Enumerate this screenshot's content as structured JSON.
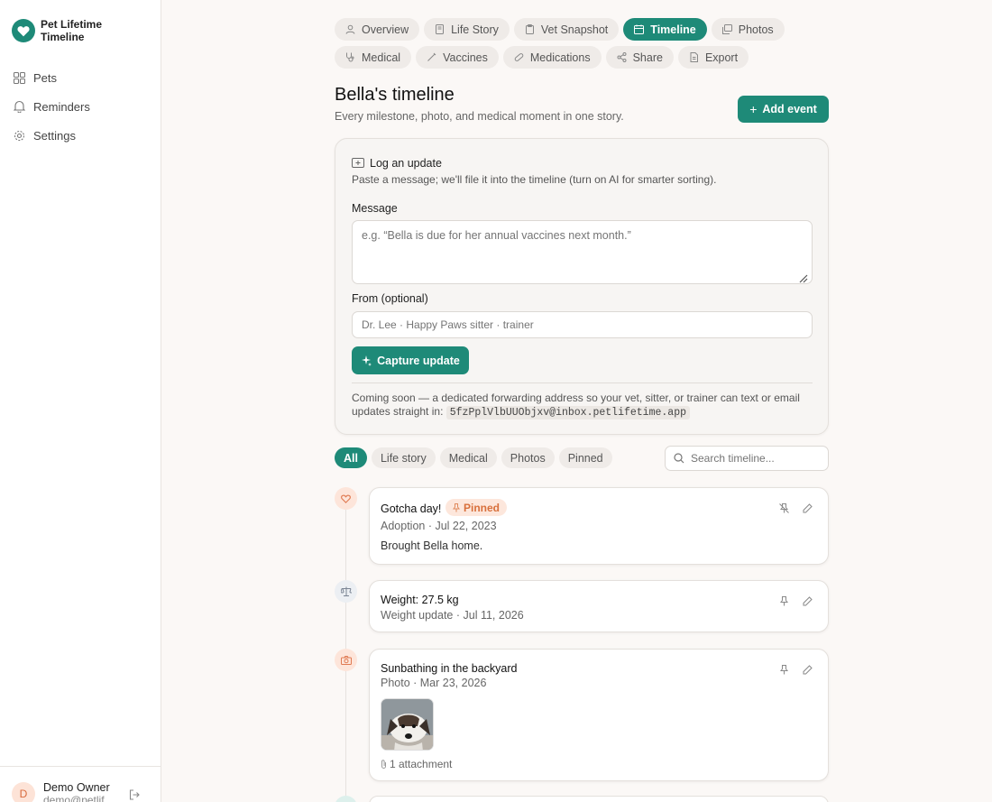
{
  "app": {
    "name": "Pet Lifetime Timeline"
  },
  "sidebar": {
    "items": [
      {
        "label": "Pets",
        "icon": "grid-icon"
      },
      {
        "label": "Reminders",
        "icon": "bell-icon"
      },
      {
        "label": "Settings",
        "icon": "gear-icon"
      }
    ],
    "user": {
      "initial": "D",
      "name": "Demo Owner",
      "email": "demo@petlif"
    }
  },
  "tabs": [
    {
      "label": "Overview",
      "icon": "user-icon",
      "active": false
    },
    {
      "label": "Life Story",
      "icon": "book-icon",
      "active": false
    },
    {
      "label": "Vet Snapshot",
      "icon": "clipboard-icon",
      "active": false
    },
    {
      "label": "Timeline",
      "icon": "calendar-icon",
      "active": true
    },
    {
      "label": "Photos",
      "icon": "images-icon",
      "active": false
    },
    {
      "label": "Medical",
      "icon": "stethoscope-icon",
      "active": false
    },
    {
      "label": "Vaccines",
      "icon": "syringe-icon",
      "active": false
    },
    {
      "label": "Medications",
      "icon": "pill-icon",
      "active": false
    },
    {
      "label": "Share",
      "icon": "share-icon",
      "active": false
    },
    {
      "label": "Export",
      "icon": "file-icon",
      "active": false
    }
  ],
  "header": {
    "title": "Bella's timeline",
    "subtitle": "Every milestone, photo, and medical moment in one story.",
    "add_event": "Add event"
  },
  "log": {
    "title": "Log an update",
    "description": "Paste a message; we'll file it into the timeline (turn on AI for smarter sorting).",
    "message_label": "Message",
    "message_placeholder": "e.g. “Bella is due for her annual vaccines next month.”",
    "from_label": "From (optional)",
    "from_placeholder": "Dr. Lee · Happy Paws sitter · trainer",
    "capture_label": "Capture update",
    "coming_soon": "Coming soon — a dedicated forwarding address so your vet, sitter, or trainer can text or email updates straight in:",
    "address": "5fzPplVlbUUObjxv@inbox.petlifetime.app"
  },
  "filters": {
    "chips": [
      {
        "label": "All",
        "active": true
      },
      {
        "label": "Life story",
        "active": false
      },
      {
        "label": "Medical",
        "active": false
      },
      {
        "label": "Photos",
        "active": false
      },
      {
        "label": "Pinned",
        "active": false
      }
    ],
    "search_placeholder": "Search timeline..."
  },
  "events": [
    {
      "title": "Gotcha day!",
      "badge": "Pinned",
      "meta": "Adoption · Jul 22, 2023",
      "body": "Brought Bella home.",
      "icon": "heart-icon"
    },
    {
      "title": "Weight: 27.5 kg",
      "meta": "Weight update · Jul 11, 2026",
      "icon": "scale-icon"
    },
    {
      "title": "Sunbathing in the backyard",
      "meta": "Photo · Mar 23, 2026",
      "attachment": "1 attachment",
      "icon": "camera-icon"
    }
  ],
  "colors": {
    "accent": "#1e8a78",
    "pinned": "#d8703c",
    "background": "#fbf8f6"
  }
}
